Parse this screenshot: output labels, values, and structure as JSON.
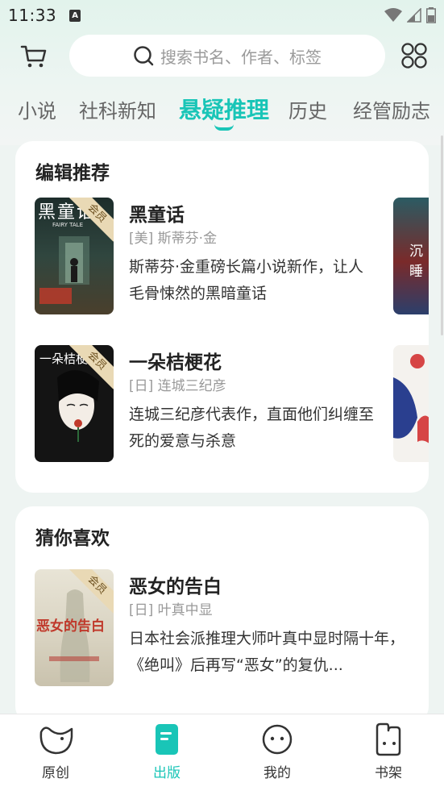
{
  "status_bar": {
    "time": "11:33",
    "notification_icon": "A"
  },
  "header": {
    "search_placeholder": "搜索书名、作者、标签"
  },
  "tabs": [
    {
      "label": "小说"
    },
    {
      "label": "社科新知"
    },
    {
      "label": "悬疑推理"
    },
    {
      "label": "历史"
    },
    {
      "label": "经管励志"
    }
  ],
  "active_tab": "悬疑推理",
  "editor_picks": {
    "title": "编辑推荐",
    "books": [
      {
        "title": "黑童话",
        "author": "[美] 斯蒂芬·金",
        "description": "斯蒂芬·金重磅长篇小说新作，让人毛骨悚然的黑暗童话",
        "badge": "会员",
        "cover_title": "黑童话",
        "cover_subtitle": "FAIRY TALE"
      },
      {
        "title": "一朵桔梗花",
        "author": "[日] 连城三纪彦",
        "description": "连城三纪彦代表作，直面他们纠缠至死的爱意与杀意",
        "badge": "会员",
        "cover_title": "一朵桔梗花"
      }
    ],
    "side_covers": [
      {
        "text": "沉睡"
      },
      {
        "text": ""
      }
    ]
  },
  "guess_you_like": {
    "title": "猜你喜欢",
    "books": [
      {
        "title": "恶女的告白",
        "author": "[日] 叶真中显",
        "description": "日本社会派推理大师叶真中显时隔十年，《绝叫》后再写“恶女”的复仇...",
        "badge": "会员",
        "cover_title": "恶女的告白"
      }
    ]
  },
  "bottom_nav": [
    {
      "label": "原创",
      "icon": "bird-icon"
    },
    {
      "label": "出版",
      "icon": "book-icon",
      "active": true
    },
    {
      "label": "我的",
      "icon": "face-icon"
    },
    {
      "label": "书架",
      "icon": "bookshelf-icon"
    }
  ],
  "colors": {
    "accent": "#19c5b7",
    "badge": "#e9d9b5"
  }
}
